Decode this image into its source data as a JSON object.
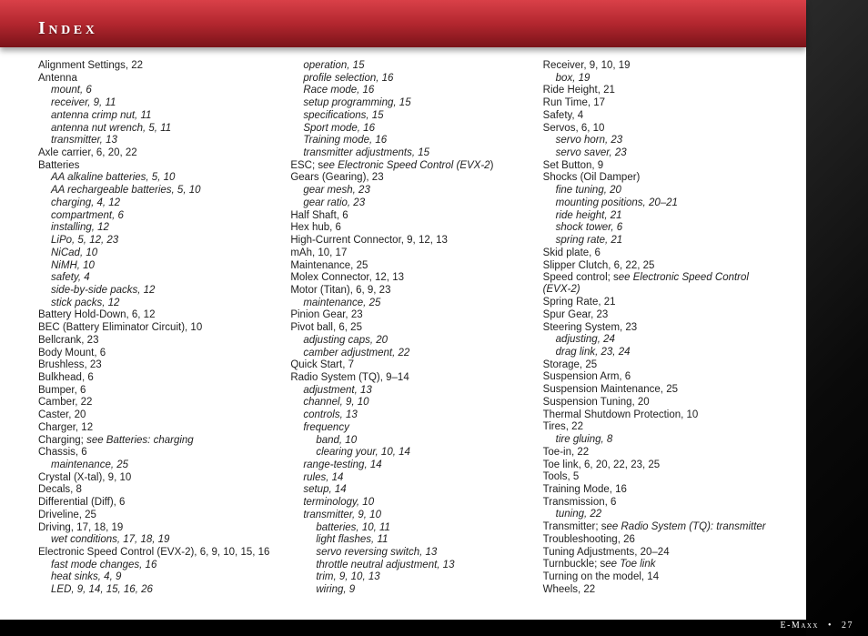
{
  "header": {
    "title": "Index"
  },
  "footer": {
    "product": "E-Maxx",
    "sep": "•",
    "page": "27"
  },
  "index": [
    {
      "t": "Alignment Settings, 22"
    },
    {
      "t": "Antenna"
    },
    {
      "t": "mount, 6",
      "lvl": 1
    },
    {
      "t": "receiver, 9, 11",
      "lvl": 1
    },
    {
      "t": "antenna crimp nut, 11",
      "lvl": 1
    },
    {
      "t": "antenna nut wrench, 5, 11",
      "lvl": 1
    },
    {
      "t": "transmitter, 13",
      "lvl": 1
    },
    {
      "t": "Axle carrier, 6, 20, 22"
    },
    {
      "t": "Batteries"
    },
    {
      "t": "AA alkaline batteries, 5, 10",
      "lvl": 1
    },
    {
      "t": "AA rechargeable batteries, 5, 10",
      "lvl": 1
    },
    {
      "t": "charging, 4, 12",
      "lvl": 1
    },
    {
      "t": "compartment, 6",
      "lvl": 1
    },
    {
      "t": "installing, 12",
      "lvl": 1
    },
    {
      "t": "LiPo, 5, 12, 23",
      "lvl": 1
    },
    {
      "t": "NiCad, 10",
      "lvl": 1
    },
    {
      "t": "NiMH, 10",
      "lvl": 1
    },
    {
      "t": "safety, 4",
      "lvl": 1
    },
    {
      "t": "side-by-side packs, 12",
      "lvl": 1
    },
    {
      "t": "stick packs, 12",
      "lvl": 1
    },
    {
      "t": "Battery Hold-Down, 6, 12"
    },
    {
      "t": "BEC (Battery Eliminator Circuit), 10"
    },
    {
      "t": "Bellcrank, 23"
    },
    {
      "t": "Body Mount, 6"
    },
    {
      "t": "Brushless, 23"
    },
    {
      "t": "Bulkhead, 6"
    },
    {
      "t": "Bumper, 6"
    },
    {
      "t": "Camber, 22"
    },
    {
      "t": "Caster, 20"
    },
    {
      "t": "Charger, 12"
    },
    {
      "xref": true,
      "plain": "Charging; ",
      "see": "see Batteries: charging"
    },
    {
      "t": "Chassis, 6"
    },
    {
      "t": "maintenance, 25",
      "lvl": 1
    },
    {
      "t": "Crystal (X-tal), 9, 10"
    },
    {
      "t": "Decals, 8"
    },
    {
      "t": "Differential (Diff), 6"
    },
    {
      "t": "Driveline, 25"
    },
    {
      "t": "Driving, 17, 18, 19"
    },
    {
      "t": "wet conditions, 17, 18, 19",
      "lvl": 1
    },
    {
      "t": "Electronic Speed Control (EVX-2), 6, 9, 10, 15, 16"
    },
    {
      "t": "fast mode changes, 16",
      "lvl": 1
    },
    {
      "t": "heat sinks, 4, 9",
      "lvl": 1
    },
    {
      "t": "LED, 9, 14, 15, 16, 26",
      "lvl": 1
    },
    {
      "t": "operation, 15",
      "lvl": 1
    },
    {
      "t": "profile selection, 16",
      "lvl": 1
    },
    {
      "t": "Race mode, 16",
      "lvl": 1
    },
    {
      "t": "setup programming, 15",
      "lvl": 1
    },
    {
      "t": "specifications, 15",
      "lvl": 1
    },
    {
      "t": "Sport mode, 16",
      "lvl": 1
    },
    {
      "t": "Training mode, 16",
      "lvl": 1
    },
    {
      "t": "transmitter adjustments, 15",
      "lvl": 1
    },
    {
      "xref": true,
      "plain": "ESC; s",
      "see": "ee Electronic Speed Control (EVX-2",
      "tail": ")"
    },
    {
      "t": "Gears (Gearing), 23"
    },
    {
      "t": "gear mesh, 23",
      "lvl": 1
    },
    {
      "t": "gear ratio, 23",
      "lvl": 1
    },
    {
      "t": "Half Shaft, 6"
    },
    {
      "t": "Hex hub, 6"
    },
    {
      "t": "High-Current Connector, 9, 12, 13"
    },
    {
      "t": "mAh, 10, 17"
    },
    {
      "t": "Maintenance, 25"
    },
    {
      "t": "Molex Connector, 12, 13"
    },
    {
      "t": "Motor (Titan), 6, 9, 23"
    },
    {
      "t": "maintenance, 25",
      "lvl": 1
    },
    {
      "t": "Pinion Gear, 23"
    },
    {
      "t": "Pivot ball, 6, 25"
    },
    {
      "t": "adjusting caps, 20",
      "lvl": 1
    },
    {
      "t": "camber adjustment, 22",
      "lvl": 1
    },
    {
      "t": "Quick Start, 7"
    },
    {
      "t": "Radio System (TQ), 9–14"
    },
    {
      "t": "adjustment, 13",
      "lvl": 1
    },
    {
      "t": "channel, 9, 10",
      "lvl": 1
    },
    {
      "t": "controls, 13",
      "lvl": 1
    },
    {
      "t": "frequency",
      "lvl": 1
    },
    {
      "t": "band, 10",
      "lvl": 2
    },
    {
      "t": "clearing your, 10, 14",
      "lvl": 2
    },
    {
      "t": "range-testing, 14",
      "lvl": 1
    },
    {
      "t": "rules, 14",
      "lvl": 1
    },
    {
      "t": "setup, 14",
      "lvl": 1
    },
    {
      "t": "terminology, 10",
      "lvl": 1
    },
    {
      "t": "transmitter, 9, 10",
      "lvl": 1
    },
    {
      "t": "batteries, 10, 11",
      "lvl": 2
    },
    {
      "t": "light flashes, 11",
      "lvl": 2
    },
    {
      "t": "servo reversing switch, 13",
      "lvl": 2
    },
    {
      "t": "throttle neutral adjustment, 13",
      "lvl": 2
    },
    {
      "t": "trim, 9, 10, 13",
      "lvl": 2
    },
    {
      "t": "wiring, 9",
      "lvl": 2
    },
    {
      "t": "Receiver, 9, 10, 19"
    },
    {
      "t": "box, 19",
      "lvl": 1
    },
    {
      "t": "Ride Height, 21"
    },
    {
      "t": "Run Time, 17"
    },
    {
      "t": "Safety, 4"
    },
    {
      "t": "Servos, 6, 10"
    },
    {
      "t": "servo horn, 23",
      "lvl": 1
    },
    {
      "t": "servo saver, 23",
      "lvl": 1
    },
    {
      "t": "Set Button, 9"
    },
    {
      "t": "Shocks (Oil Damper)"
    },
    {
      "t": "fine tuning, 20",
      "lvl": 1
    },
    {
      "t": "mounting positions, 20–21",
      "lvl": 1
    },
    {
      "t": "ride height, 21",
      "lvl": 1
    },
    {
      "t": "shock tower, 6",
      "lvl": 1
    },
    {
      "t": "spring rate, 21",
      "lvl": 1
    },
    {
      "t": "Skid plate, 6"
    },
    {
      "t": "Slipper Clutch, 6, 22, 25"
    },
    {
      "xref": true,
      "plain": "Speed control; s",
      "see": "ee Electronic Speed Control (EVX-2)"
    },
    {
      "t": "Spring Rate, 21"
    },
    {
      "t": "Spur Gear, 23"
    },
    {
      "t": "Steering System, 23"
    },
    {
      "t": "adjusting, 24",
      "lvl": 1
    },
    {
      "t": "drag link, 23, 24",
      "lvl": 1
    },
    {
      "t": "Storage, 25"
    },
    {
      "t": "Suspension Arm, 6"
    },
    {
      "t": "Suspension Maintenance, 25"
    },
    {
      "t": "Suspension Tuning, 20"
    },
    {
      "t": "Thermal Shutdown Protection, 10"
    },
    {
      "t": "Tires, 22"
    },
    {
      "t": "tire gluing, 8",
      "lvl": 1
    },
    {
      "t": "Toe-in, 22"
    },
    {
      "t": "Toe link, 6, 20, 22, 23, 25"
    },
    {
      "t": "Tools, 5"
    },
    {
      "t": "Training Mode, 16"
    },
    {
      "t": "Transmission, 6"
    },
    {
      "t": "tuning, 22",
      "lvl": 1
    },
    {
      "xref": true,
      "plain": "Transmitter; s",
      "see": "ee Radio System (TQ): transmitter"
    },
    {
      "t": "Troubleshooting, 26"
    },
    {
      "t": "Tuning Adjustments, 20–24"
    },
    {
      "xref": true,
      "plain": "Turnbuckle; s",
      "see": "ee Toe link"
    },
    {
      "t": "Turning on the model, 14"
    },
    {
      "t": "Wheels, 22"
    }
  ]
}
